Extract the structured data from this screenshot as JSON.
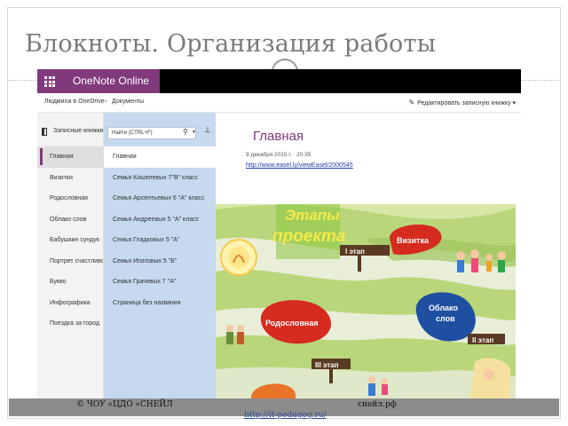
{
  "slide": {
    "title": "Блокноты. Организация работы",
    "footer_org": "© ЧОУ «ЦДО «СНЕЙЛ",
    "footer_site": "снейл.рф",
    "footer_url": "http://it-pedagog.ru/"
  },
  "app": {
    "name": "OneNote Online",
    "accent_color": "#80397b",
    "breadcrumb": [
      "Людмила в OneDrive",
      "Документы"
    ],
    "breadcrumb_separator": "›",
    "edit_label": "Редактировать записную книжку",
    "edit_icon": "pencil-icon"
  },
  "notebook_panel": {
    "label": "Записные книжки",
    "sections": [
      "Главная",
      "Визитки",
      "Родословная",
      "Облако слов",
      "Бабушкин сундук",
      "Портрет счастливой",
      "Букво",
      "Инфографика",
      "Поездка за город"
    ],
    "selected_index": 0
  },
  "page_panel": {
    "search_placeholder": "Найти (CTRL+F)",
    "pages": [
      "Главная",
      "Семья Кошелевых 7\"В\" класс",
      "Семья Арсентьевых 6 \"А\" класс",
      "Семья Андреевых 5 \"А\" класс",
      "Семья Гладковых 5 \"А\"",
      "Семья Ипатовых 5 \"Б\"",
      "Семья Грачевых 7 \"А\"",
      "Страница без названия"
    ],
    "selected_index": 0
  },
  "page": {
    "title": "Главная",
    "date": "9 декабря 2015 г.",
    "time": "20:35",
    "link": "http://www.easel.ly/viewEasel/2000545"
  },
  "poster": {
    "title_line1": "Этапы",
    "title_line2": "проекта",
    "stage1": "I этап",
    "stage2": "II этап",
    "stage3": "III этап",
    "vizitka": "Визитка",
    "rodoslovnaya": "Родословная",
    "oblako_line1": "Облако",
    "oblako_line2": "слов"
  }
}
